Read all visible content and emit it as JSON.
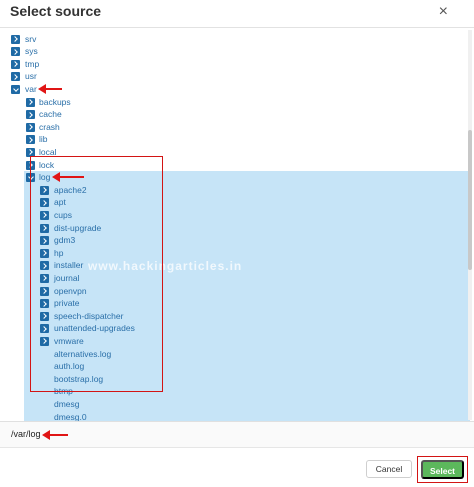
{
  "dialog": {
    "title": "Select source",
    "close_glyph": "×"
  },
  "tree": {
    "top_level": [
      {
        "label": "srv",
        "expanded": false
      },
      {
        "label": "sys",
        "expanded": false
      },
      {
        "label": "tmp",
        "expanded": false
      },
      {
        "label": "usr",
        "expanded": false
      },
      {
        "label": "var",
        "expanded": true
      }
    ],
    "var_children": [
      {
        "label": "backups",
        "expanded": false
      },
      {
        "label": "cache",
        "expanded": false
      },
      {
        "label": "crash",
        "expanded": false
      },
      {
        "label": "lib",
        "expanded": false
      },
      {
        "label": "local",
        "expanded": false
      },
      {
        "label": "lock",
        "expanded": false
      },
      {
        "label": "log",
        "expanded": true,
        "selected": true
      }
    ],
    "log_folders": [
      "apache2",
      "apt",
      "cups",
      "dist-upgrade",
      "gdm3",
      "hp",
      "installer",
      "journal",
      "openvpn",
      "private",
      "speech-dispatcher",
      "unattended-upgrades",
      "vmware"
    ],
    "log_files": [
      "alternatives.log",
      "auth.log",
      "bootstrap.log",
      "btmp",
      "dmesg",
      "dmesg.0"
    ]
  },
  "watermark": "www.hackingarticles.in",
  "path": "/var/log",
  "footer": {
    "cancel_label": "Cancel",
    "select_label": "Select"
  },
  "colors": {
    "accent": "#1f6aa5",
    "selection": "#c6e4f7",
    "annotation": "#d31414",
    "select_button": "#5cb85c"
  }
}
